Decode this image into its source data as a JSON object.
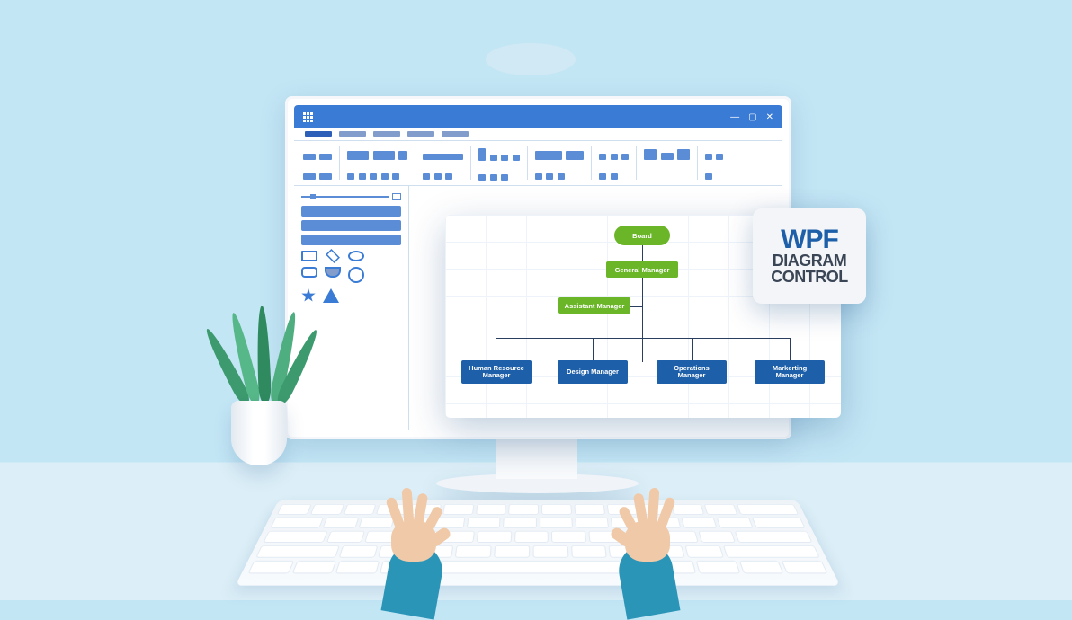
{
  "badge": {
    "line1": "WPF",
    "line2": "DIAGRAM",
    "line3": "CONTROL"
  },
  "org": {
    "board": "Board",
    "gm": "General Manager",
    "am": "Assistant Manager",
    "hr": "Human Resource Manager",
    "design": "Design Manager",
    "ops": "Operations Manager",
    "mkt": "Markerting Manager"
  }
}
